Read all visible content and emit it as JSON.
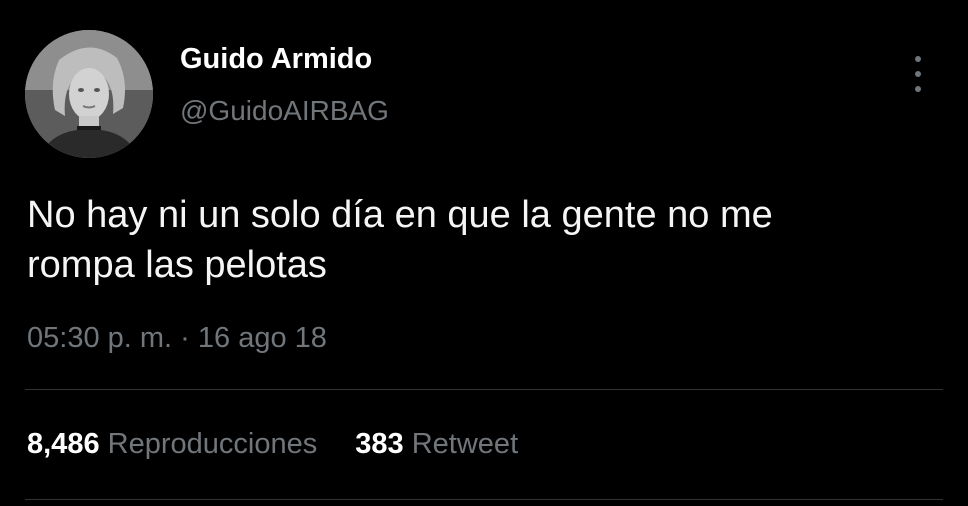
{
  "author": {
    "display_name": "Guido Armido",
    "handle": "@GuidoAIRBAG"
  },
  "tweet": {
    "text_line1": "No hay ni un solo día en que la gente no me",
    "text_line2": "rompa las pelotas",
    "time": "05:30 p. m.",
    "separator": "·",
    "date": "16 ago 18"
  },
  "stats": {
    "views_count": "8,486",
    "views_label": "Reproducciones",
    "retweets_count": "383",
    "retweets_label": "Retweet"
  },
  "icons": {
    "more": "more-vertical-icon"
  },
  "colors": {
    "background": "#000000",
    "primary_text": "#ffffff",
    "secondary_text": "#71767b",
    "divider": "#2f3336"
  }
}
